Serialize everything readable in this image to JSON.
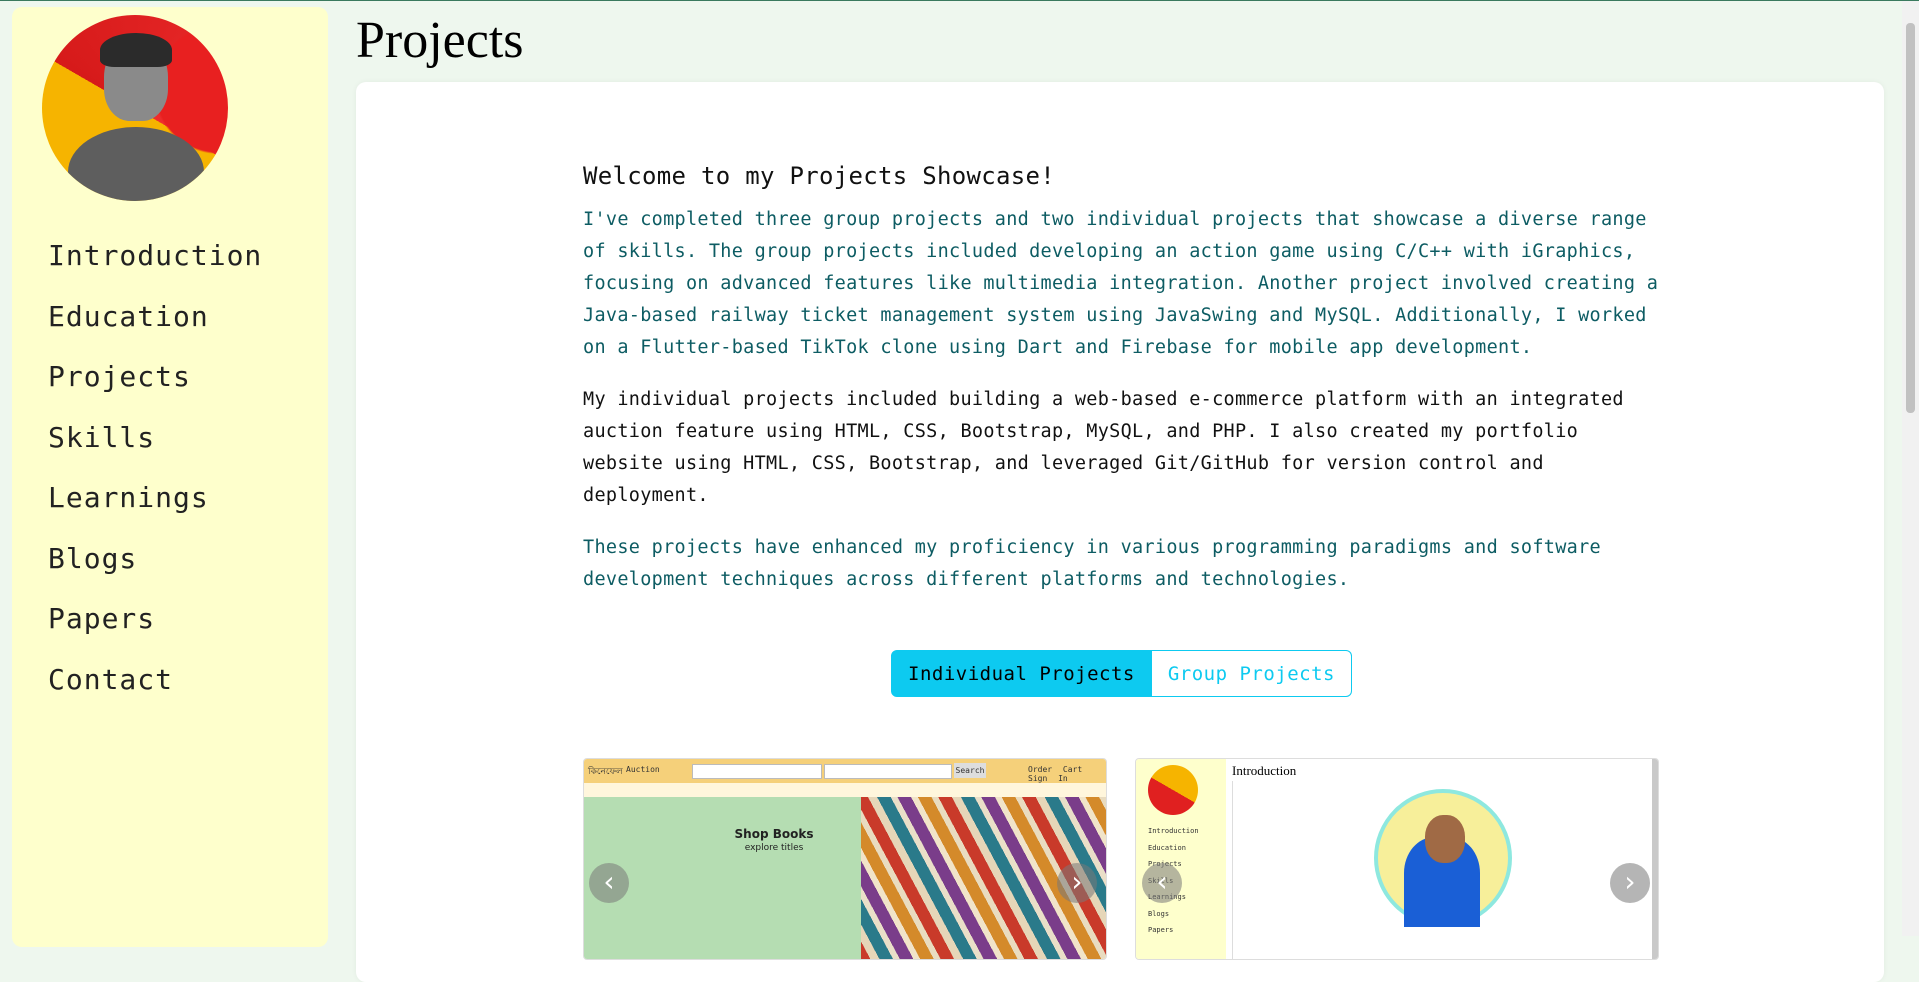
{
  "sidebar": {
    "items": [
      {
        "label": "Introduction"
      },
      {
        "label": "Education"
      },
      {
        "label": "Projects"
      },
      {
        "label": "Skills"
      },
      {
        "label": "Learnings"
      },
      {
        "label": "Blogs"
      },
      {
        "label": "Papers"
      },
      {
        "label": "Contact"
      }
    ]
  },
  "page": {
    "title": "Projects"
  },
  "showcase": {
    "heading": "Welcome to my Projects Showcase!",
    "paragraphs": [
      "I've completed three group projects and two individual projects that showcase a diverse range of skills. The group projects included developing an action game using C/C++ with iGraphics, focusing on advanced features like multimedia integration. Another project involved creating a Java-based railway ticket management system using JavaSwing and MySQL. Additionally, I worked on a Flutter-based TikTok clone using Dart and Firebase for mobile app development.",
      "My individual projects included building a web-based e-commerce platform with an integrated auction feature using HTML, CSS, Bootstrap, MySQL, and PHP. I also created my portfolio website using HTML, CSS, Bootstrap, and leveraged Git/GitHub for version control and deployment.",
      "These projects have enhanced my proficiency in various programming paradigms and software development techniques across different platforms and technologies."
    ]
  },
  "toggle": {
    "individual": "Individual Projects",
    "group": "Group Projects",
    "active": "Individual Projects"
  },
  "project1": {
    "brand": "কিনেফেল",
    "nav_auction": "Auction",
    "search_btn": "Search",
    "links": "Order Cart Sign In",
    "shop_title": "Shop Books",
    "shop_sub": "explore titles"
  },
  "project2": {
    "title": "Introduction",
    "nav": "Introduction\nEducation\nProjects\nSkills\nLearnings\nBlogs\nPapers"
  },
  "icons": {
    "prev": "chevron-left-icon",
    "next": "chevron-right-icon"
  },
  "colors": {
    "sidebar": "#feffcc",
    "accent": "#0dcaf0",
    "teal_text": "#0d5c63",
    "page_bg": "#eef7ee"
  }
}
